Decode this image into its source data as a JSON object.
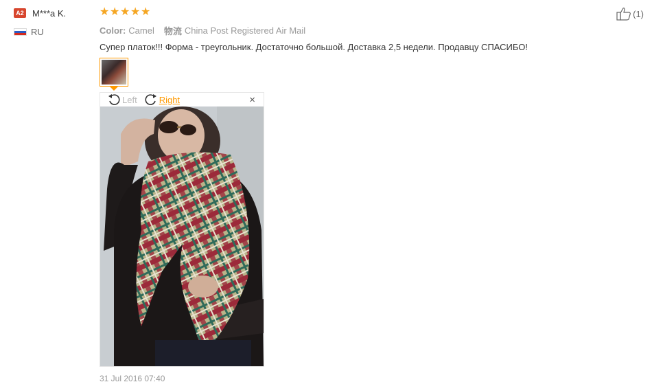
{
  "user": {
    "level_badge": "A2",
    "name": "M***a K.",
    "country_code": "RU"
  },
  "review": {
    "rating": 5,
    "stars": [
      "★",
      "★",
      "★",
      "★",
      "★"
    ],
    "color_label": "Color:",
    "color_value": "Camel",
    "shipping_label": "物流",
    "shipping_value": "China Post Registered Air Mail",
    "text": "Супер платок!!! Форма - треугольник. Достаточно большой. Доставка 2,5 недели. Продавцу СПАСИБО!",
    "date": "31 Jul 2016 07:40"
  },
  "viewer": {
    "rotate_left_label": "Left",
    "rotate_right_label": "Right",
    "close_glyph": "×"
  },
  "helpful": {
    "count_text": "(1)"
  },
  "colors": {
    "star": "#f5a623",
    "accent": "#ff9900",
    "badge": "#d7462e"
  },
  "icons": [
    "level-badge",
    "russia-flag-icon",
    "star-icon",
    "rotate-left-icon",
    "rotate-right-icon",
    "close-icon",
    "thumbs-up-icon"
  ]
}
